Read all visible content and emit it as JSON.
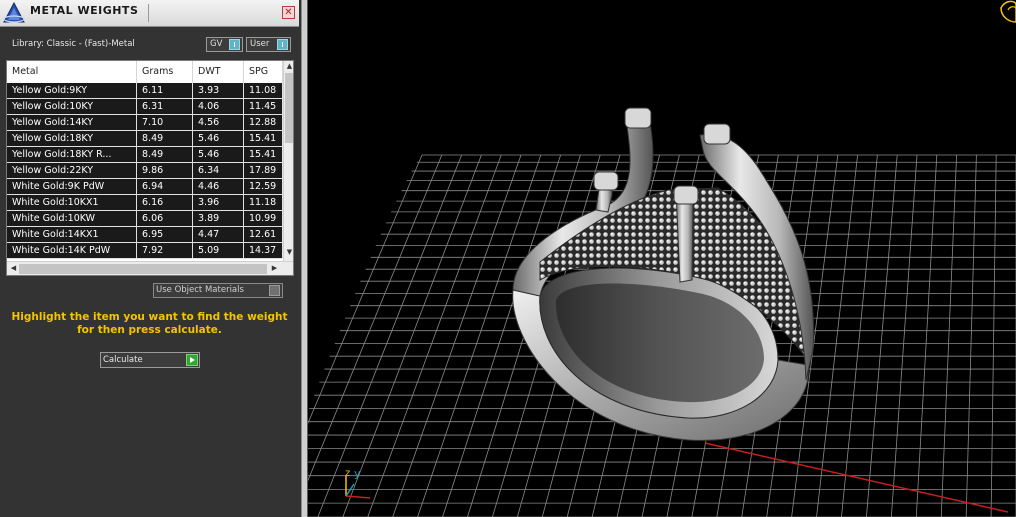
{
  "window": {
    "title": "METAL WEIGHTS",
    "close_glyph": "✕"
  },
  "library": "Library: Classic - (Fast)-Metal",
  "toggles": {
    "gv": "GV",
    "user": "User"
  },
  "table": {
    "headers": [
      "Metal",
      "Grams",
      "DWT",
      "SPG"
    ],
    "rows": [
      [
        "Yellow Gold:9KY",
        "6.11",
        "3.93",
        "11.08"
      ],
      [
        "Yellow Gold:10KY",
        "6.31",
        "4.06",
        "11.45"
      ],
      [
        "Yellow Gold:14KY",
        "7.10",
        "4.56",
        "12.88"
      ],
      [
        "Yellow Gold:18KY",
        "8.49",
        "5.46",
        "15.41"
      ],
      [
        "Yellow Gold:18KY R...",
        "8.49",
        "5.46",
        "15.41"
      ],
      [
        "Yellow Gold:22KY",
        "9.86",
        "6.34",
        "17.89"
      ],
      [
        "White Gold:9K PdW",
        "6.94",
        "4.46",
        "12.59"
      ],
      [
        "White Gold:10KX1",
        "6.16",
        "3.96",
        "11.18"
      ],
      [
        "White Gold:10KW",
        "6.06",
        "3.89",
        "10.99"
      ],
      [
        "White Gold:14KX1",
        "6.95",
        "4.47",
        "12.61"
      ],
      [
        "White Gold:14K PdW",
        "7.92",
        "5.09",
        "14.37"
      ]
    ]
  },
  "use_object_materials": {
    "label": "Use Object Materials",
    "checked": false
  },
  "hint": {
    "line1": "Highlight the item you want to find the weight",
    "line2": "for then press calculate."
  },
  "calculate_label": "Calculate",
  "viewport": {
    "axis_labels": {
      "z": "z",
      "y": "y"
    },
    "colors": {
      "grid": "#8a8a8a",
      "x_axis": "#c81e1e",
      "y_axis": "#1e9bb4",
      "hint": "#f5c400"
    }
  },
  "icons": [
    "app-logo-icon",
    "close-icon",
    "toggle-knob-icon",
    "checkbox-icon",
    "play-arrow-icon",
    "scroll-up-arrow-icon",
    "scroll-down-arrow-icon",
    "scroll-left-arrow-icon",
    "scroll-right-arrow-icon",
    "axis-gizmo-icon",
    "view-cube-icon"
  ]
}
